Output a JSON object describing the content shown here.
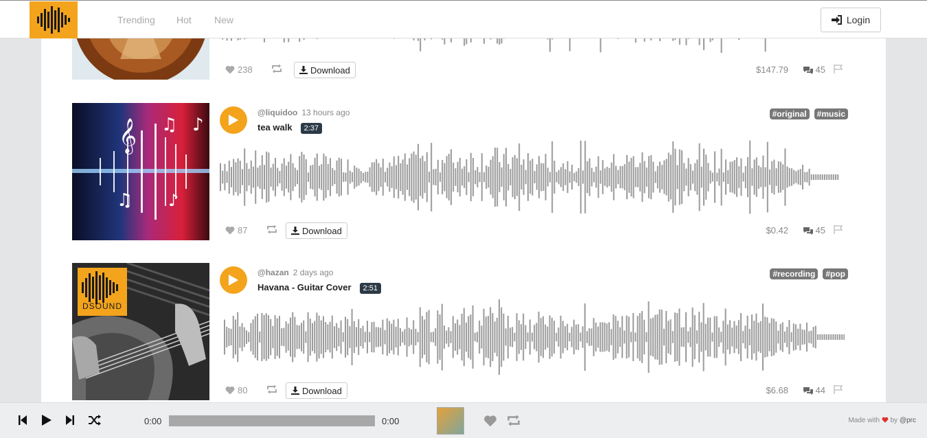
{
  "nav": {
    "links": [
      "Trending",
      "Hot",
      "New"
    ],
    "login_label": "Login"
  },
  "tracks": [
    {
      "author": "",
      "time_ago": "",
      "title": "",
      "duration": "",
      "tags": [],
      "likes": "238",
      "download_label": "Download",
      "price": "$147.79",
      "comments": "45"
    },
    {
      "author": "@liquidoo",
      "time_ago": "13 hours ago",
      "title": "tea walk",
      "duration": "2:37",
      "tags": [
        "#original",
        "#music"
      ],
      "likes": "87",
      "download_label": "Download",
      "price": "$0.42",
      "comments": "45"
    },
    {
      "author": "@hazan",
      "time_ago": "2 days ago",
      "title": "Havana - Guitar Cover",
      "duration": "2:51",
      "tags": [
        "#recording",
        "#pop"
      ],
      "likes": "80",
      "download_label": "Download",
      "price": "$6.68",
      "comments": "44",
      "thumb_text": "DSOUND"
    }
  ],
  "player": {
    "current_time": "0:00",
    "total_time": "0:00",
    "progress": 0,
    "made_with": "Made with",
    "by": "by",
    "credit": "@prc"
  },
  "colors": {
    "accent": "#f3a41c",
    "wave": "#9a9a9a",
    "tag_bg": "#777777",
    "duration_bg": "#2b3a46",
    "heart_red": "#e0302a"
  }
}
